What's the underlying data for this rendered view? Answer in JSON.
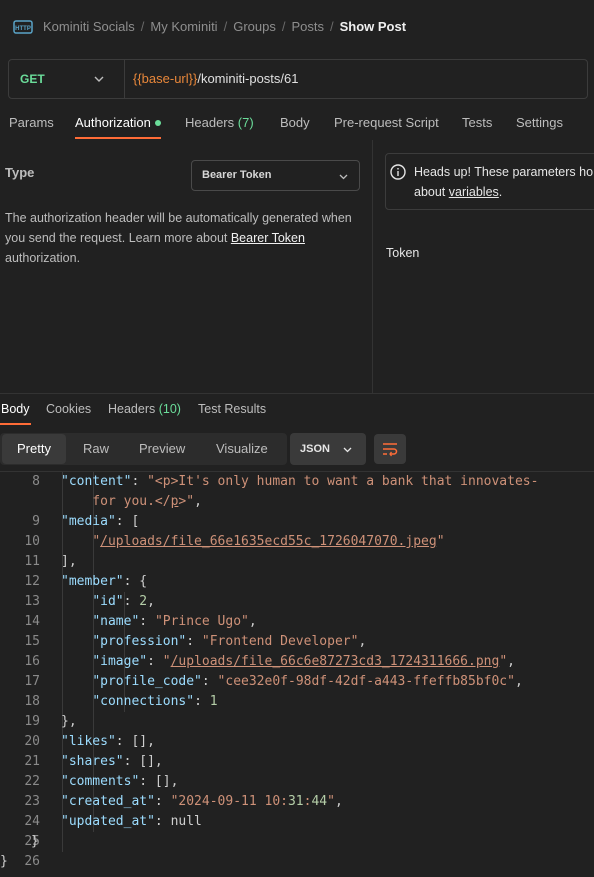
{
  "breadcrumb": {
    "items": [
      "Kominiti Socials",
      "My Kominiti",
      "Groups",
      "Posts"
    ],
    "current": "Show Post",
    "separator": "/"
  },
  "request": {
    "method": "GET",
    "url_var": "{{base-url}}",
    "url_path": "/kominiti-posts/61"
  },
  "request_tabs": [
    {
      "label": "Params"
    },
    {
      "label": "Authorization"
    },
    {
      "label": "Headers",
      "count": "(7)"
    },
    {
      "label": "Body"
    },
    {
      "label": "Pre-request Script"
    },
    {
      "label": "Tests"
    },
    {
      "label": "Settings"
    }
  ],
  "auth": {
    "type_label": "Type",
    "type_value": "Bearer Token",
    "description_1": "The authorization header will be automatically generated when you send the request. Learn more about ",
    "description_link": "Bearer Token",
    "description_2": " authorization.",
    "notice_1": "Heads up! These parameters ho",
    "notice_2a": "about ",
    "notice_link": "variables",
    "notice_2b": ".",
    "token_label": "Token"
  },
  "response_tabs": [
    {
      "label": "Body"
    },
    {
      "label": "Cookies"
    },
    {
      "label": "Headers",
      "count": "(10)"
    },
    {
      "label": "Test Results"
    }
  ],
  "view_modes": [
    "Pretty",
    "Raw",
    "Preview",
    "Visualize"
  ],
  "format": "JSON",
  "code_lines": [
    {
      "n": "8",
      "t": "\"content\": \"<p>It's only human to want a bank that innovates-"
    },
    {
      "n": "",
      "t": "    for you.</p>\","
    },
    {
      "n": "9",
      "t": "\"media\": ["
    },
    {
      "n": "10",
      "t": "    \"/uploads/file_66e1635ecd55c_1726047070.jpeg\""
    },
    {
      "n": "11",
      "t": "],"
    },
    {
      "n": "12",
      "t": "\"member\": {"
    },
    {
      "n": "13",
      "t": "    \"id\": 2,"
    },
    {
      "n": "14",
      "t": "    \"name\": \"Prince Ugo\","
    },
    {
      "n": "15",
      "t": "    \"profession\": \"Frontend Developer\","
    },
    {
      "n": "16",
      "t": "    \"image\": \"/uploads/file_66c6e87273cd3_1724311666.png\","
    },
    {
      "n": "17",
      "t": "    \"profile_code\": \"cee32e0f-98df-42df-a443-ffeffb85bf0c\","
    },
    {
      "n": "18",
      "t": "    \"connections\": 1"
    },
    {
      "n": "19",
      "t": "},"
    },
    {
      "n": "20",
      "t": "\"likes\": [],"
    },
    {
      "n": "21",
      "t": "\"shares\": [],"
    },
    {
      "n": "22",
      "t": "\"comments\": [],"
    },
    {
      "n": "23",
      "t": "\"created_at\": \"2024-09-11 10:31:44\","
    },
    {
      "n": "24",
      "t": "\"updated_at\": null"
    },
    {
      "n": "25",
      "t": "}"
    },
    {
      "n": "26",
      "t": "}"
    }
  ],
  "colors": {
    "accent": "#ff6c37",
    "method_get": "#6bdd9a",
    "variable": "#e8873a",
    "json_key": "#9cdcfe",
    "json_string": "#ce9178"
  }
}
